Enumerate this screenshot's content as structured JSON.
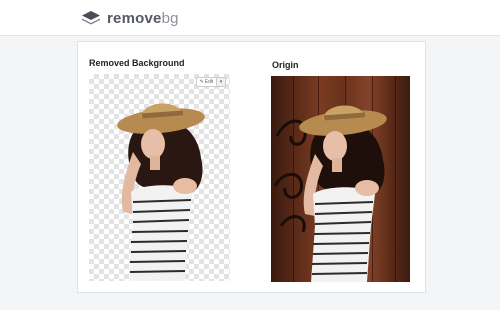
{
  "header": {
    "logo_icon": "layers-icon",
    "logo_text_primary": "remove",
    "logo_text_accent": "bg"
  },
  "panels": {
    "left_title": "Removed Background",
    "right_title": "Origin",
    "edit_label": "Edit",
    "edit_icon": "pencil-icon",
    "dropdown_icon": "chevron-down-icon"
  },
  "colors": {
    "logo_text": "#555a61",
    "wood_dark": "#3a1a10",
    "wood_mid": "#7a3b22",
    "hat": "#c49a5c",
    "hair": "#2a1712",
    "shirt_stripe": "#2b2b2b"
  }
}
